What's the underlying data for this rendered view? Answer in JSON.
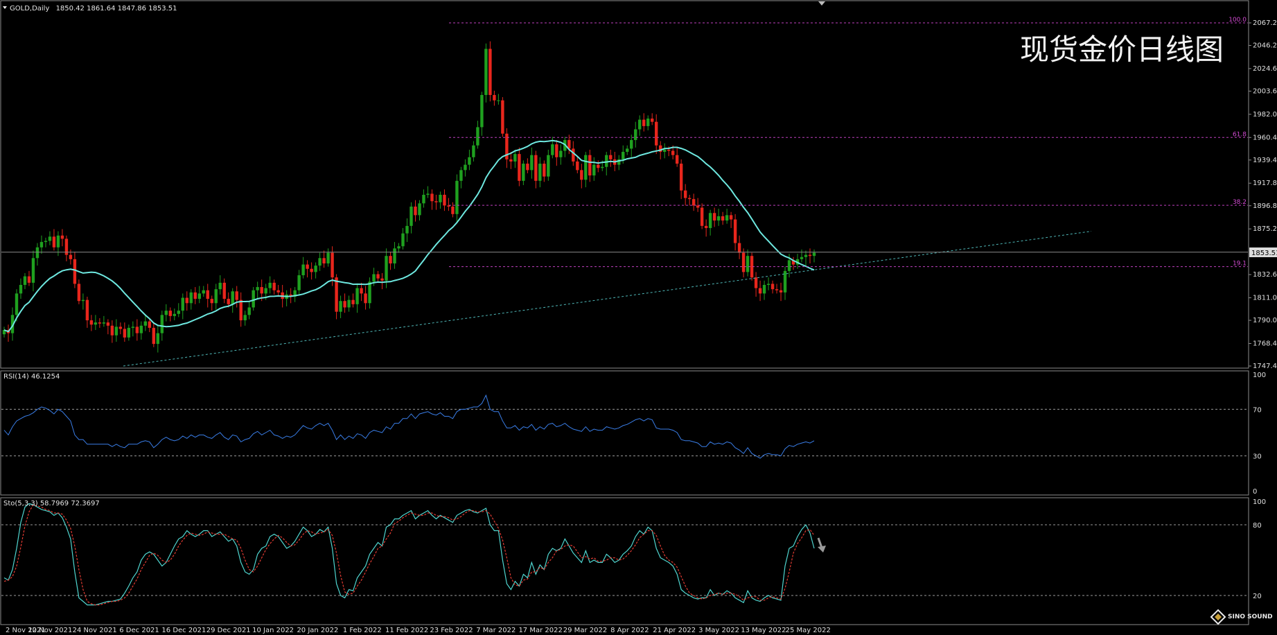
{
  "main_header": {
    "symbol": "GOLD,Daily",
    "ohlc": "1850.42 1861.64 1847.86 1853.51"
  },
  "overlay_title": "现货金价日线图",
  "rsi_header": "RSI(14) 46.1254",
  "sto_header": "Sto(5,3,3) 58.7969 72.3697",
  "current_price_label": "1853.51",
  "logo_text": "SINO SOUND",
  "colors": {
    "background": "#000000",
    "bull": "#1fa01f",
    "bear": "#e8261c",
    "ma": "#6ee8e0",
    "fib": "#c040c0",
    "rsi": "#3a7ee8",
    "sto_main": "#4fd6d0",
    "sto_signal": "#e23b32"
  },
  "chart_data": [
    {
      "type": "candlestick",
      "title": "GOLD,Daily",
      "ylim": [
        1747.4,
        2067.2
      ],
      "price_ticks": [
        "2067.20",
        "2046.20",
        "2024.60",
        "2003.60",
        "1982.00",
        "1960.40",
        "1939.40",
        "1917.80",
        "1896.80",
        "1875.20",
        "1853.51",
        "1832.60",
        "1811.00",
        "1790.00",
        "1768.40",
        "1747.40"
      ],
      "x_labels": [
        "2 Nov 2021",
        "12 Nov 2021",
        "24 Nov 2021",
        "6 Dec 2021",
        "16 Dec 2021",
        "29 Dec 2021",
        "10 Jan 2022",
        "20 Jan 2022",
        "1 Feb 2022",
        "11 Feb 2022",
        "23 Feb 2022",
        "7 Mar 2022",
        "17 Mar 2022",
        "29 Mar 2022",
        "8 Apr 2022",
        "21 Apr 2022",
        "3 May 2022",
        "13 May 2022",
        "25 May 2022"
      ],
      "series": [
        {
          "name": "GOLD,Daily",
          "close": [
            1781,
            1778,
            1795,
            1815,
            1823,
            1831,
            1825,
            1848,
            1858,
            1863,
            1864,
            1868,
            1858,
            1869,
            1866,
            1851,
            1847,
            1824,
            1808,
            1809,
            1790,
            1786,
            1788,
            1787,
            1788,
            1785,
            1776,
            1784,
            1782,
            1774,
            1783,
            1784,
            1778,
            1785,
            1789,
            1783,
            1768,
            1778,
            1795,
            1799,
            1794,
            1796,
            1799,
            1811,
            1806,
            1816,
            1810,
            1815,
            1818,
            1810,
            1806,
            1819,
            1825,
            1810,
            1805,
            1817,
            1809,
            1790,
            1795,
            1802,
            1818,
            1821,
            1815,
            1820,
            1825,
            1818,
            1816,
            1810,
            1814,
            1812,
            1818,
            1832,
            1842,
            1838,
            1835,
            1841,
            1848,
            1843,
            1853,
            1830,
            1798,
            1808,
            1802,
            1809,
            1805,
            1820,
            1815,
            1806,
            1826,
            1833,
            1829,
            1827,
            1850,
            1843,
            1857,
            1859,
            1871,
            1878,
            1896,
            1888,
            1899,
            1907,
            1908,
            1901,
            1900,
            1907,
            1897,
            1896,
            1889,
            1920,
            1930,
            1935,
            1942,
            1953,
            1970,
            2000,
            2043,
            2000,
            1995,
            1995,
            1964,
            1940,
            1938,
            1945,
            1920,
            1936,
            1930,
            1944,
            1920,
            1936,
            1924,
            1944,
            1954,
            1942,
            1948,
            1958,
            1950,
            1938,
            1930,
            1921,
            1944,
            1925,
            1935,
            1932,
            1933,
            1944,
            1940,
            1935,
            1940,
            1947,
            1950,
            1958,
            1968,
            1977,
            1971,
            1978,
            1975,
            1953,
            1947,
            1949,
            1948,
            1944,
            1936,
            1911,
            1904,
            1903,
            1897,
            1895,
            1878,
            1876,
            1890,
            1883,
            1887,
            1883,
            1888,
            1884,
            1862,
            1853,
            1835,
            1850,
            1830,
            1820,
            1815,
            1823,
            1824,
            1819,
            1818,
            1816,
            1836,
            1846,
            1842,
            1847,
            1849,
            1851,
            1850,
            1853
          ]
        }
      ]
    },
    {
      "type": "line",
      "title": "RSI(14) 46.1254",
      "ylim": [
        0,
        100
      ],
      "y_ticks": [
        100,
        70,
        30,
        0
      ],
      "series": [
        {
          "name": "RSI(14) 46.1254",
          "values": [
            52,
            48,
            55,
            60,
            62,
            64,
            65,
            67,
            70,
            72,
            71,
            69,
            66,
            70,
            68,
            64,
            60,
            48,
            44,
            44,
            40,
            40,
            40,
            40,
            40,
            40,
            38,
            40,
            38,
            37,
            40,
            40,
            40,
            42,
            43,
            42,
            37,
            40,
            44,
            46,
            44,
            43,
            44,
            47,
            45,
            48,
            46,
            48,
            48,
            46,
            45,
            48,
            50,
            46,
            44,
            48,
            47,
            42,
            44,
            45,
            49,
            51,
            48,
            50,
            52,
            48,
            47,
            45,
            47,
            46,
            48,
            52,
            56,
            54,
            53,
            56,
            58,
            56,
            58,
            52,
            44,
            48,
            44,
            47,
            45,
            49,
            48,
            45,
            50,
            52,
            51,
            50,
            55,
            53,
            58,
            58,
            62,
            62,
            66,
            62,
            66,
            67,
            68,
            66,
            65,
            67,
            64,
            64,
            62,
            68,
            70,
            70,
            71,
            72,
            72,
            75,
            82,
            70,
            68,
            68,
            60,
            54,
            54,
            56,
            52,
            55,
            54,
            57,
            52,
            55,
            53,
            57,
            58,
            55,
            56,
            58,
            55,
            53,
            52,
            51,
            55,
            51,
            53,
            52,
            52,
            55,
            54,
            53,
            54,
            56,
            57,
            59,
            61,
            62,
            60,
            62,
            61,
            54,
            53,
            53,
            53,
            52,
            50,
            44,
            43,
            43,
            42,
            41,
            38,
            38,
            42,
            40,
            41,
            40,
            42,
            41,
            37,
            35,
            32,
            37,
            32,
            30,
            28,
            31,
            32,
            31,
            31,
            30,
            36,
            39,
            38,
            40,
            41,
            42,
            41,
            43
          ]
        }
      ]
    },
    {
      "type": "line",
      "title": "Sto(5,3,3) 58.7969 72.3697",
      "ylim": [
        0,
        100
      ],
      "y_ticks": [
        100,
        80,
        20
      ],
      "series": [
        {
          "name": "Sto",
          "values": [
            35,
            33,
            42,
            60,
            82,
            95,
            98,
            97,
            95,
            93,
            92,
            91,
            88,
            90,
            86,
            78,
            68,
            40,
            18,
            15,
            12,
            12,
            12,
            13,
            14,
            15,
            15,
            16,
            17,
            22,
            28,
            35,
            40,
            50,
            55,
            57,
            55,
            50,
            45,
            48,
            55,
            62,
            68,
            70,
            75,
            72,
            70,
            72,
            75,
            75,
            70,
            72,
            74,
            70,
            66,
            68,
            62,
            48,
            40,
            38,
            42,
            55,
            60,
            62,
            70,
            72,
            70,
            65,
            60,
            62,
            66,
            72,
            78,
            75,
            70,
            72,
            76,
            74,
            78,
            60,
            30,
            20,
            18,
            25,
            24,
            35,
            40,
            45,
            55,
            60,
            65,
            62,
            78,
            80,
            85,
            85,
            88,
            90,
            92,
            85,
            88,
            90,
            92,
            88,
            85,
            88,
            86,
            84,
            82,
            88,
            90,
            92,
            93,
            91,
            90,
            92,
            94,
            80,
            75,
            75,
            50,
            30,
            25,
            32,
            28,
            38,
            35,
            48,
            38,
            46,
            42,
            55,
            60,
            58,
            60,
            68,
            62,
            56,
            52,
            48,
            58,
            48,
            50,
            48,
            48,
            55,
            52,
            48,
            50,
            55,
            58,
            62,
            70,
            75,
            72,
            78,
            75,
            60,
            52,
            50,
            48,
            45,
            38,
            25,
            22,
            20,
            18,
            17,
            18,
            18,
            25,
            20,
            22,
            21,
            24,
            22,
            18,
            16,
            14,
            24,
            18,
            16,
            15,
            18,
            20,
            18,
            17,
            16,
            45,
            60,
            62,
            70,
            76,
            80,
            73,
            60
          ]
        },
        {
          "name": "Signal",
          "values": [
            32,
            33,
            36,
            45,
            61,
            79,
            91,
            97,
            96,
            95,
            93,
            92,
            90,
            90,
            89,
            84,
            77,
            62,
            42,
            25,
            15,
            13,
            12,
            12,
            13,
            14,
            15,
            15,
            16,
            18,
            22,
            28,
            34,
            42,
            48,
            54,
            56,
            54,
            50,
            48,
            50,
            55,
            62,
            67,
            71,
            73,
            72,
            71,
            72,
            74,
            73,
            72,
            72,
            72,
            70,
            68,
            67,
            60,
            50,
            42,
            40,
            45,
            52,
            59,
            64,
            68,
            71,
            69,
            65,
            62,
            63,
            67,
            72,
            75,
            74,
            72,
            73,
            74,
            76,
            71,
            56,
            37,
            23,
            21,
            22,
            28,
            33,
            40,
            47,
            53,
            60,
            62,
            68,
            73,
            81,
            83,
            86,
            88,
            90,
            89,
            88,
            88,
            90,
            90,
            88,
            87,
            87,
            86,
            84,
            85,
            87,
            90,
            92,
            92,
            91,
            91,
            92,
            89,
            83,
            77,
            67,
            52,
            35,
            29,
            28,
            33,
            34,
            40,
            40,
            44,
            42,
            48,
            52,
            58,
            59,
            62,
            63,
            62,
            57,
            52,
            53,
            51,
            52,
            49,
            49,
            50,
            52,
            52,
            50,
            51,
            54,
            58,
            63,
            69,
            72,
            75,
            75,
            71,
            62,
            54,
            50,
            48,
            44,
            36,
            28,
            22,
            20,
            18,
            17,
            18,
            20,
            21,
            22,
            21,
            22,
            22,
            21,
            19,
            16,
            18,
            19,
            19,
            16,
            16,
            18,
            19,
            18,
            17,
            26,
            40,
            56,
            64,
            69,
            75,
            76,
            71
          ]
        }
      ]
    }
  ]
}
